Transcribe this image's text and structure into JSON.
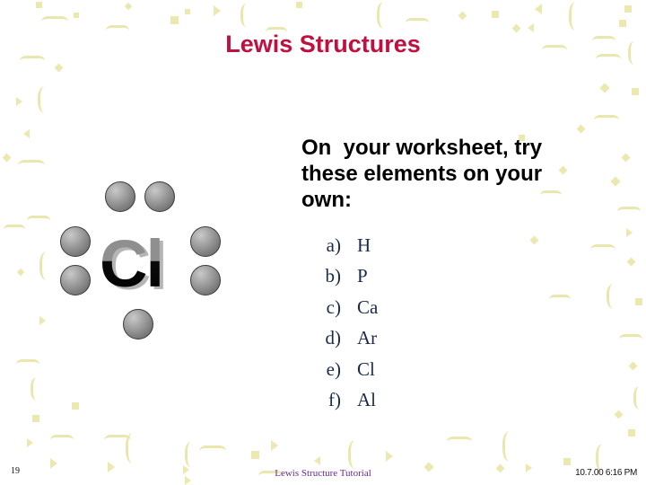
{
  "slide": {
    "title": "Lewis Structures",
    "title_color": "#bf1040",
    "background_color": "#ffffff"
  },
  "diagram": {
    "element_symbol": "Cl",
    "valence_electron_count": 7,
    "dot_color": "#8a8a8a",
    "dots": [
      {
        "name": "dot-top-left",
        "position": "top-left"
      },
      {
        "name": "dot-top-right",
        "position": "top-right"
      },
      {
        "name": "dot-left-upper",
        "position": "left-upper"
      },
      {
        "name": "dot-left-lower",
        "position": "left-lower"
      },
      {
        "name": "dot-right-upper",
        "position": "right-upper"
      },
      {
        "name": "dot-right-lower",
        "position": "right-lower"
      },
      {
        "name": "dot-bottom",
        "position": "bottom"
      }
    ]
  },
  "body": {
    "heading": "On  your worksheet, try these elements on your own:",
    "list_color": "#1b2a4a",
    "items": [
      {
        "marker": "a)",
        "value": "H"
      },
      {
        "marker": "b)",
        "value": "P"
      },
      {
        "marker": "c)",
        "value": "Ca"
      },
      {
        "marker": "d)",
        "value": "Ar"
      },
      {
        "marker": "e)",
        "value": "Cl"
      },
      {
        "marker": "f)",
        "value": "Al"
      }
    ]
  },
  "footer": {
    "page_number": "19",
    "center_text": "Lewis Structure Tutorial",
    "center_color": "#6b2a8e",
    "timestamp": "10.7.00 6:16 PM"
  },
  "decor": {
    "confetti_color": "#ece9b0",
    "icon_names": [
      "confetti-square",
      "confetti-diamond",
      "confetti-triangle",
      "confetti-squiggle",
      "confetti-curl"
    ]
  }
}
